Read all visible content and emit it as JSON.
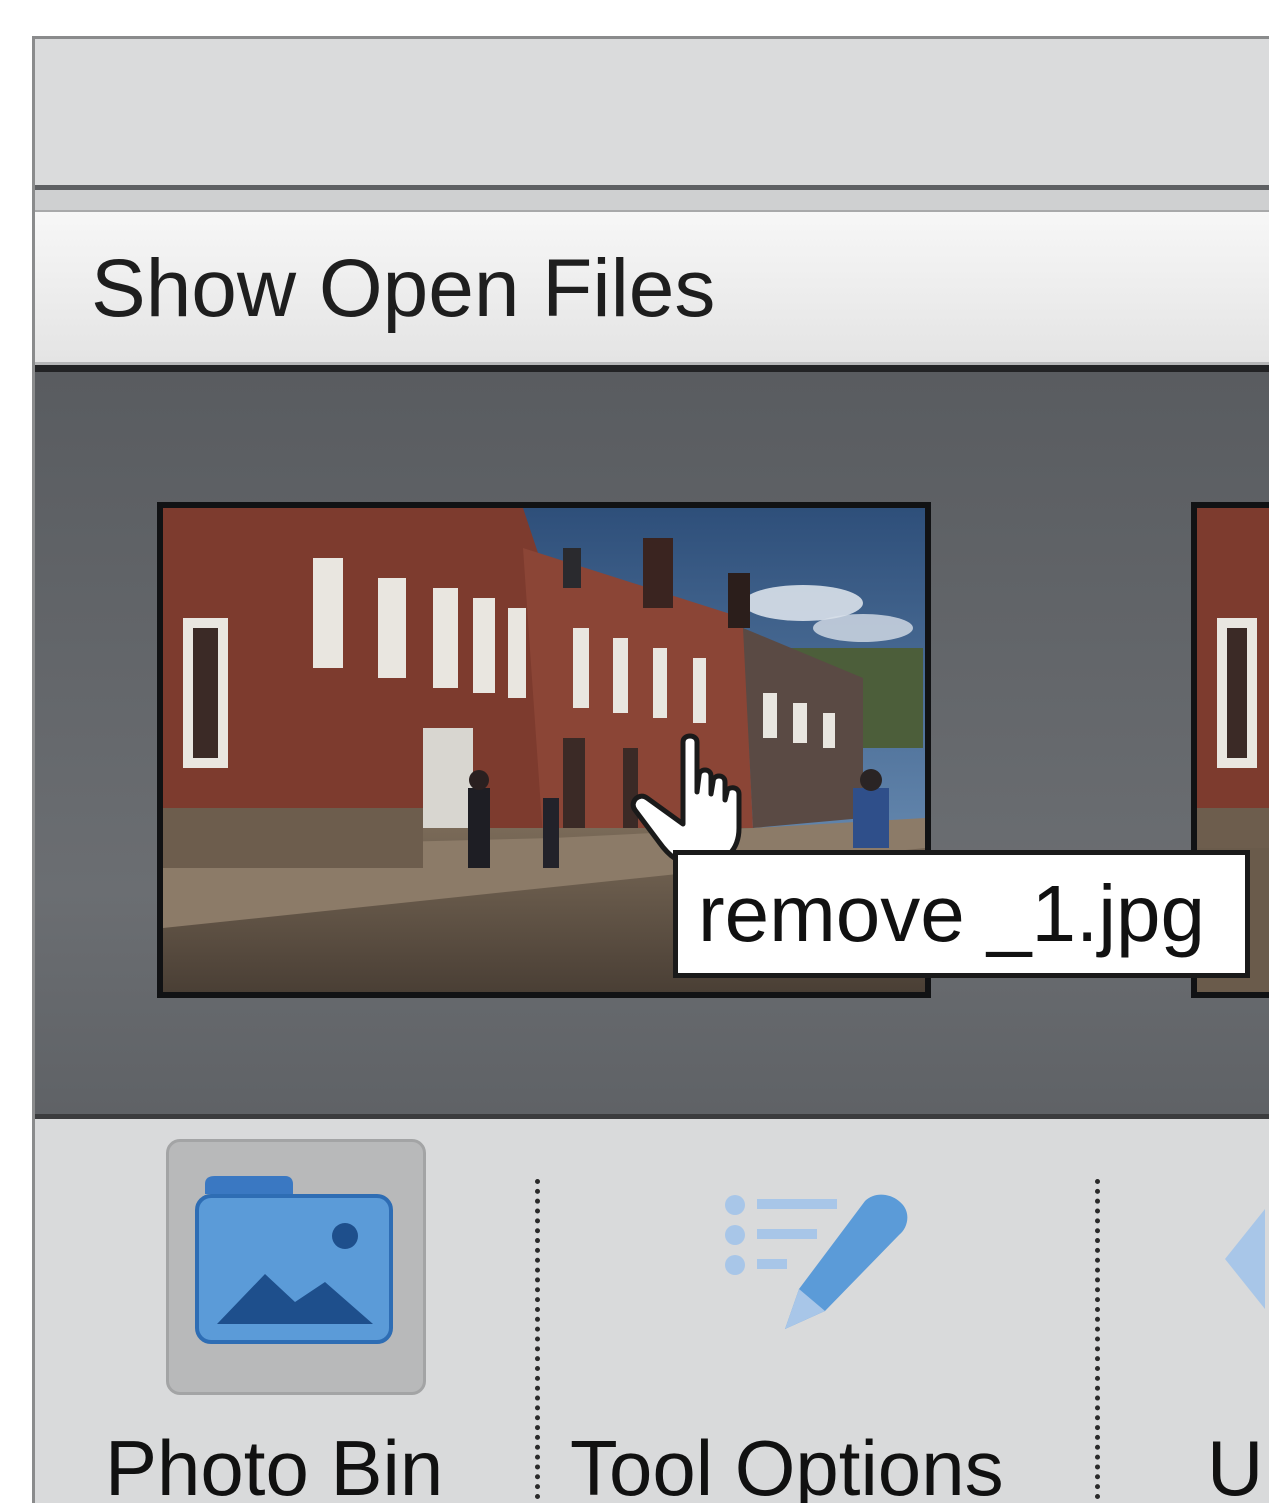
{
  "dropdown": {
    "label": "Show Open Files"
  },
  "photo_bin": {
    "thumbnails": [
      {
        "file": "remove _1.jpg"
      }
    ],
    "tooltip": "remove _1.jpg"
  },
  "panel_bar": {
    "buttons": [
      {
        "label": "Photo Bin",
        "icon": "photo-bin-icon",
        "active": true
      },
      {
        "label": "Tool Options",
        "icon": "tool-options-icon",
        "active": false
      },
      {
        "label": "U",
        "icon": "undo-icon",
        "active": false
      }
    ]
  },
  "colors": {
    "bin_background": "#65686c",
    "panel_background": "#d9dadb",
    "icon_blue": "#5b9bd8",
    "icon_dark_blue": "#2e6db4"
  }
}
